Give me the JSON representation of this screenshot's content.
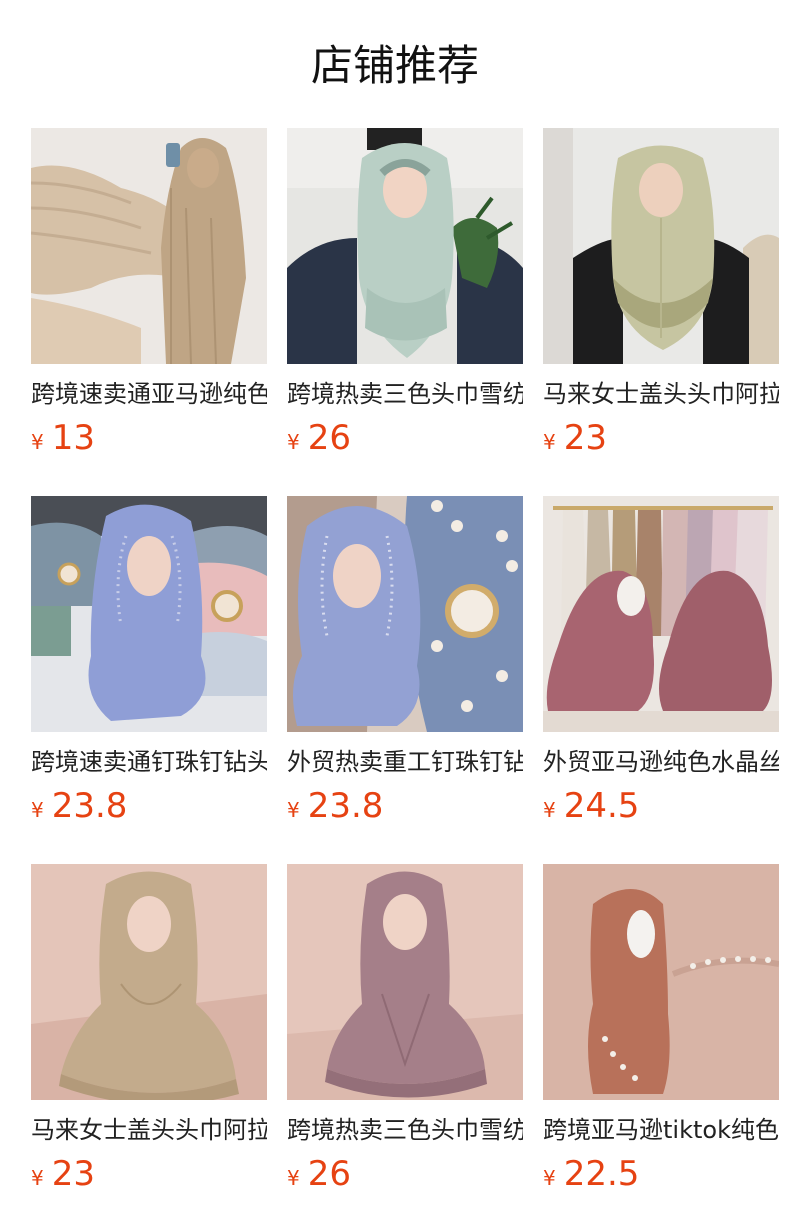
{
  "page": {
    "title": "店铺推荐"
  },
  "colors": {
    "price": "#e64212",
    "title": "#111111"
  },
  "products": [
    {
      "name": "跨境速卖通亚马逊纯色",
      "currency": "¥",
      "price": "13",
      "image": "beige-hijab-abaya-photo"
    },
    {
      "name": "跨境热卖三色头巾雪纺",
      "currency": "¥",
      "price": "26",
      "image": "mint-layered-hijab-photo"
    },
    {
      "name": "马来女士盖头头巾阿拉",
      "currency": "¥",
      "price": "23",
      "image": "sage-layered-hijab-photo"
    },
    {
      "name": "跨境速卖通钉珠钉钻头",
      "currency": "¥",
      "price": "23.8",
      "image": "lavender-pearl-hijab-photo"
    },
    {
      "name": "外贸热卖重工钉珠钉钻",
      "currency": "¥",
      "price": "23.8",
      "image": "lavender-pearl-hijab-closeup-photo"
    },
    {
      "name": "外贸亚马逊纯色水晶丝",
      "currency": "¥",
      "price": "24.5",
      "image": "mauve-hijab-rack-photo"
    },
    {
      "name": "马来女士盖头头巾阿拉",
      "currency": "¥",
      "price": "23",
      "image": "tan-hijab-mannequin-photo"
    },
    {
      "name": "跨境热卖三色头巾雪纺",
      "currency": "¥",
      "price": "26",
      "image": "dusty-rose-hijab-mannequin-photo"
    },
    {
      "name": "跨境亚马逊tiktok纯色",
      "currency": "¥",
      "price": "22.5",
      "image": "terracotta-beaded-hijab-photo"
    }
  ]
}
